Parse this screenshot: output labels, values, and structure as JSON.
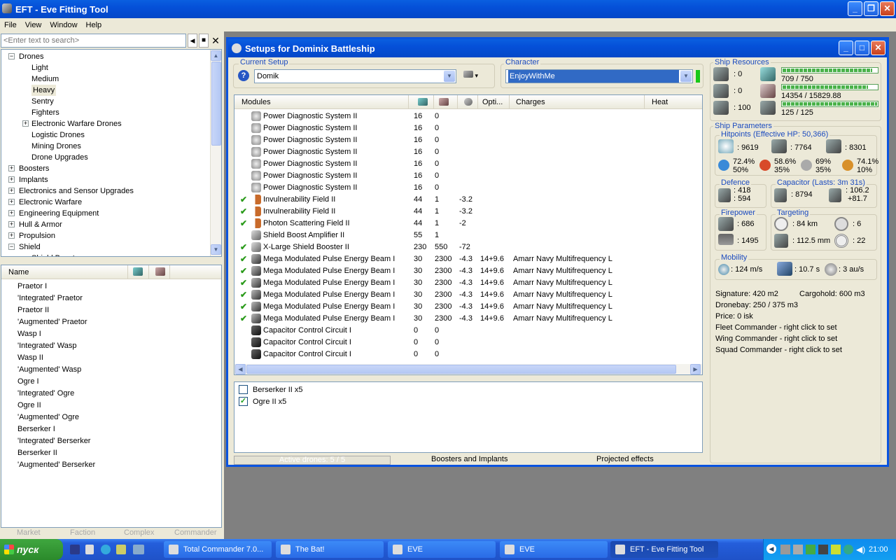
{
  "app": {
    "title": "EFT - Eve Fitting Tool"
  },
  "menu": [
    "File",
    "View",
    "Window",
    "Help"
  ],
  "search": {
    "placeholder": "<Enter text to search>"
  },
  "tree": [
    {
      "label": "Drones",
      "level": 0,
      "expander": "−"
    },
    {
      "label": "Light",
      "level": 1
    },
    {
      "label": "Medium",
      "level": 1
    },
    {
      "label": "Heavy",
      "level": 1,
      "selected": true
    },
    {
      "label": "Sentry",
      "level": 1
    },
    {
      "label": "Fighters",
      "level": 1
    },
    {
      "label": "Electronic Warfare Drones",
      "level": 1,
      "expander": "+"
    },
    {
      "label": "Logistic Drones",
      "level": 1
    },
    {
      "label": "Mining Drones",
      "level": 1
    },
    {
      "label": "Drone Upgrades",
      "level": 1
    },
    {
      "label": "Boosters",
      "level": 0,
      "expander": "+"
    },
    {
      "label": "Implants",
      "level": 0,
      "expander": "+"
    },
    {
      "label": "Electronics and Sensor Upgrades",
      "level": 0,
      "expander": "+"
    },
    {
      "label": "Electronic Warfare",
      "level": 0,
      "expander": "+"
    },
    {
      "label": "Engineering Equipment",
      "level": 0,
      "expander": "+"
    },
    {
      "label": "Hull & Armor",
      "level": 0,
      "expander": "+"
    },
    {
      "label": "Propulsion",
      "level": 0,
      "expander": "+"
    },
    {
      "label": "Shield",
      "level": 0,
      "expander": "−"
    },
    {
      "label": "Shield Boosters",
      "level": 1
    }
  ],
  "list_header": {
    "name": "Name"
  },
  "items": [
    "Praetor I",
    "'Integrated' Praetor",
    "Praetor II",
    "'Augmented' Praetor",
    "Wasp I",
    "'Integrated' Wasp",
    "Wasp II",
    "'Augmented' Wasp",
    "Ogre I",
    "'Integrated' Ogre",
    "Ogre II",
    "'Augmented' Ogre",
    "Berserker I",
    "'Integrated' Berserker",
    "Berserker II",
    "'Augmented' Berserker"
  ],
  "bottom_tabs": [
    "Market",
    "Faction",
    "Complex",
    "Commander"
  ],
  "setup_window": {
    "title": "Setups for Dominix Battleship",
    "current_setup_label": "Current Setup",
    "current_setup": "Domik",
    "character_label": "Character",
    "character": "EnjoyWithMe"
  },
  "modules_header": {
    "modules": "Modules",
    "opti": "Opti...",
    "charges": "Charges",
    "heat": "Heat"
  },
  "modules": [
    {
      "name": "Power Diagnostic System II",
      "c1": "16",
      "c2": "0",
      "c3": "",
      "c4": "",
      "charge": "",
      "check": false,
      "icon": "pds"
    },
    {
      "name": "Power Diagnostic System II",
      "c1": "16",
      "c2": "0",
      "c3": "",
      "c4": "",
      "charge": "",
      "check": false,
      "icon": "pds"
    },
    {
      "name": "Power Diagnostic System II",
      "c1": "16",
      "c2": "0",
      "c3": "",
      "c4": "",
      "charge": "",
      "check": false,
      "icon": "pds"
    },
    {
      "name": "Power Diagnostic System II",
      "c1": "16",
      "c2": "0",
      "c3": "",
      "c4": "",
      "charge": "",
      "check": false,
      "icon": "pds"
    },
    {
      "name": "Power Diagnostic System II",
      "c1": "16",
      "c2": "0",
      "c3": "",
      "c4": "",
      "charge": "",
      "check": false,
      "icon": "pds"
    },
    {
      "name": "Power Diagnostic System II",
      "c1": "16",
      "c2": "0",
      "c3": "",
      "c4": "",
      "charge": "",
      "check": false,
      "icon": "pds"
    },
    {
      "name": "Power Diagnostic System II",
      "c1": "16",
      "c2": "0",
      "c3": "",
      "c4": "",
      "charge": "",
      "check": false,
      "icon": "pds"
    },
    {
      "name": "Invulnerability Field II",
      "c1": "44",
      "c2": "1",
      "c3": "-3.2",
      "c4": "",
      "charge": "",
      "check": true,
      "icon": "shield"
    },
    {
      "name": "Invulnerability Field II",
      "c1": "44",
      "c2": "1",
      "c3": "-3.2",
      "c4": "",
      "charge": "",
      "check": true,
      "icon": "shield"
    },
    {
      "name": "Photon Scattering Field II",
      "c1": "44",
      "c2": "1",
      "c3": "-2",
      "c4": "",
      "charge": "",
      "check": true,
      "icon": "shield"
    },
    {
      "name": "Shield Boost Amplifier II",
      "c1": "55",
      "c2": "1",
      "c3": "",
      "c4": "",
      "charge": "",
      "check": false,
      "icon": "amp"
    },
    {
      "name": "X-Large Shield Booster II",
      "c1": "230",
      "c2": "550",
      "c3": "-72",
      "c4": "",
      "charge": "",
      "check": true,
      "icon": "amp"
    },
    {
      "name": "Mega Modulated Pulse Energy Beam I",
      "c1": "30",
      "c2": "2300",
      "c3": "-4.3",
      "c4": "14+9.6",
      "charge": "Amarr Navy Multifrequency L",
      "check": true,
      "icon": "gun"
    },
    {
      "name": "Mega Modulated Pulse Energy Beam I",
      "c1": "30",
      "c2": "2300",
      "c3": "-4.3",
      "c4": "14+9.6",
      "charge": "Amarr Navy Multifrequency L",
      "check": true,
      "icon": "gun"
    },
    {
      "name": "Mega Modulated Pulse Energy Beam I",
      "c1": "30",
      "c2": "2300",
      "c3": "-4.3",
      "c4": "14+9.6",
      "charge": "Amarr Navy Multifrequency L",
      "check": true,
      "icon": "gun"
    },
    {
      "name": "Mega Modulated Pulse Energy Beam I",
      "c1": "30",
      "c2": "2300",
      "c3": "-4.3",
      "c4": "14+9.6",
      "charge": "Amarr Navy Multifrequency L",
      "check": true,
      "icon": "gun"
    },
    {
      "name": "Mega Modulated Pulse Energy Beam I",
      "c1": "30",
      "c2": "2300",
      "c3": "-4.3",
      "c4": "14+9.6",
      "charge": "Amarr Navy Multifrequency L",
      "check": true,
      "icon": "gun"
    },
    {
      "name": "Mega Modulated Pulse Energy Beam I",
      "c1": "30",
      "c2": "2300",
      "c3": "-4.3",
      "c4": "14+9.6",
      "charge": "Amarr Navy Multifrequency L",
      "check": true,
      "icon": "gun"
    },
    {
      "name": "Capacitor Control Circuit I",
      "c1": "0",
      "c2": "0",
      "c3": "",
      "c4": "",
      "charge": "",
      "check": false,
      "icon": "rig"
    },
    {
      "name": "Capacitor Control Circuit I",
      "c1": "0",
      "c2": "0",
      "c3": "",
      "c4": "",
      "charge": "",
      "check": false,
      "icon": "rig"
    },
    {
      "name": "Capacitor Control Circuit I",
      "c1": "0",
      "c2": "0",
      "c3": "",
      "c4": "",
      "charge": "",
      "check": false,
      "icon": "rig"
    }
  ],
  "drones": [
    {
      "label": "Berserker II x5",
      "checked": false
    },
    {
      "label": "Ogre II x5",
      "checked": true
    }
  ],
  "bottom_bar": {
    "active_drones": "Active drones: 5 / 5",
    "boosters": "Boosters and Implants",
    "projected": "Projected effects"
  },
  "resources": {
    "title": "Ship Resources",
    "turret": ": 0",
    "launcher": ": 0",
    "calibration": ": 100",
    "cpu": "709 / 750",
    "cpu_fill": 0.945,
    "pg": "14354 / 15829.88",
    "pg_fill": 0.907,
    "drone_bw": "125 / 125",
    "drone_fill": 1.0
  },
  "params": {
    "title": "Ship Parameters",
    "hp_label": "Hitpoints (Effective HP: 50,366)",
    "shield_hp": ": 9619",
    "armor_hp": ": 7764",
    "structure_hp": ": 8301",
    "em": "72.4%",
    "em2": "50%",
    "th": "58.6%",
    "th2": "35%",
    "ki": "69%",
    "ki2": "35%",
    "ex": "74.1%",
    "ex2": "10%",
    "defence_label": "Defence",
    "def1": ": 418",
    "def2": ": 594",
    "cap_label": "Capacitor (Lasts: 3m 31s)",
    "cap1": ": 8794",
    "cap2": ": 106.2",
    "cap3": "+81.7",
    "fire_label": "Firepower",
    "fire1": ": 686",
    "fire2": ": 1495",
    "target_label": "Targeting",
    "t1": ": 84 km",
    "t2": ": 6",
    "t3": ": 112.5 mm",
    "t4": ": 22",
    "mob_label": "Mobility",
    "m1": ": 124 m/s",
    "m2": ": 10.7 s",
    "m3": ": 3 au/s",
    "signature": "Signature: 420 m2",
    "cargohold": "Cargohold: 600 m3",
    "dronebay": "Dronebay: 250 / 375 m3",
    "price": "Price: 0 isk",
    "fleet": "Fleet Commander - right click to set",
    "wing": "Wing Commander - right click to set",
    "squad": "Squad Commander - right click to set"
  },
  "taskbar": {
    "start": "пуск",
    "tasks": [
      "Total Commander 7.0...",
      "The Bat!",
      "EVE",
      "EVE",
      "EFT - Eve Fitting Tool"
    ],
    "clock": "21:00"
  }
}
